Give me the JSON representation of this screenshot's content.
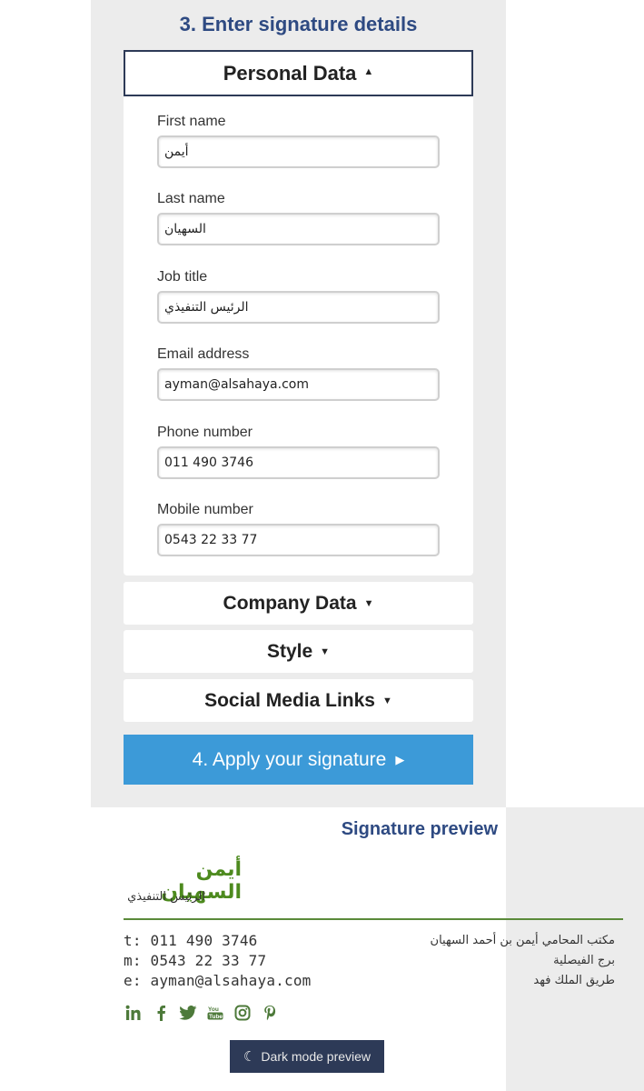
{
  "step3": {
    "title": "3. Enter signature details"
  },
  "personal": {
    "header": "Personal Data",
    "fields": [
      {
        "label": "First name",
        "value": "أيمن"
      },
      {
        "label": "Last name",
        "value": "السهيان"
      },
      {
        "label": "Job title",
        "value": "الرئيس التنفيذي"
      },
      {
        "label": "Email address",
        "value": "ayman@alsahaya.com"
      },
      {
        "label": "Phone number",
        "value": "011 490 3746"
      },
      {
        "label": "Mobile number",
        "value": "0543 22 33 77"
      }
    ]
  },
  "sections": {
    "company": "Company Data",
    "style": "Style",
    "social": "Social Media Links"
  },
  "apply": {
    "label": "4. Apply your signature"
  },
  "preview": {
    "title": "Signature preview",
    "name": "أيمن السهيان",
    "job": "الرئيس التنفيذي",
    "phone": "t: 011 490 3746",
    "mobile": "m: 0543 22 33 77",
    "email": "e: ayman@alsahaya.com",
    "address": [
      "مكتب المحامي أيمن بن أحمد السهيان",
      "برج الفيصلية",
      "طريق الملك فهد"
    ],
    "social_icons": [
      "linkedin-icon",
      "facebook-icon",
      "twitter-icon",
      "youtube-icon",
      "instagram-icon",
      "pinterest-icon"
    ],
    "dark_mode": "Dark mode preview"
  },
  "colors": {
    "accent_blue": "#2e4a82",
    "button_blue": "#3c9ad8",
    "signature_green": "#4d8a1e",
    "dark_navy": "#2d3a57"
  }
}
